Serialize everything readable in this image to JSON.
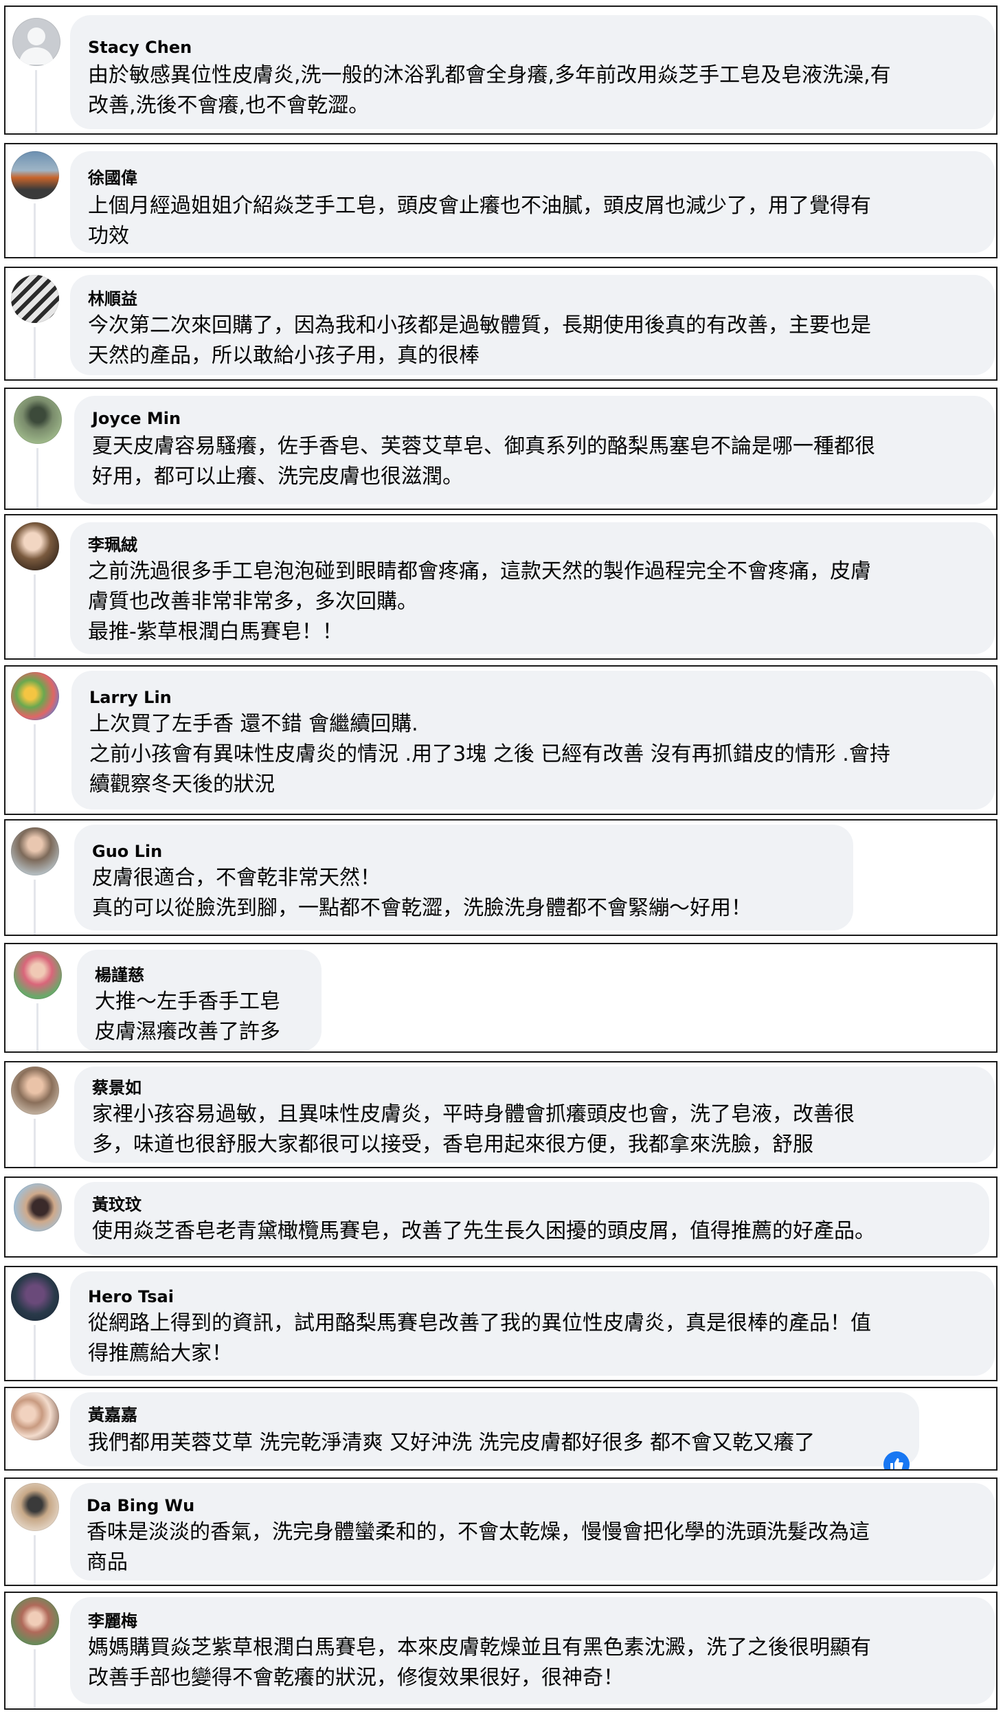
{
  "comments": [
    {
      "name": "Stacy Chen",
      "text": "由於敏感異位性皮膚炎,洗一般的沐浴乳都會全身癢,多年前改用焱芝手工皂及皂液洗澡,有\n改善,洗後不會癢,也不會乾澀。"
    },
    {
      "name": "徐國偉",
      "text": "上個月經過姐姐介紹焱芝手工皂，頭皮會止癢也不油膩，頭皮屑也減少了，用了覺得有\n功效"
    },
    {
      "name": "林順益",
      "text": "今次第二次來回購了，因為我和小孩都是過敏體質，長期使用後真的有改善，主要也是\n天然的產品，所以敢給小孩子用，真的很棒"
    },
    {
      "name": "Joyce Min",
      "text": "夏天皮膚容易騷癢，佐手香皂、芙蓉艾草皂、御真系列的酪梨馬塞皂不論是哪一種都很\n好用，都可以止癢、洗完皮膚也很滋潤。"
    },
    {
      "name": "李珮絨",
      "text": "之前洗過很多手工皂泡泡碰到眼睛都會疼痛，這款天然的製作過程完全不會疼痛，皮膚\n膚質也改善非常非常多，多次回購。\n最推-紫草根潤白馬賽皂！！"
    },
    {
      "name": "Larry Lin",
      "text": "上次買了左手香 還不錯 會繼續回購.\n之前小孩會有異味性皮膚炎的情況 .用了3塊 之後 已經有改善 沒有再抓錯皮的情形 .會持\n續觀察冬天後的狀況"
    },
    {
      "name": "Guo Lin",
      "text": "皮膚很適合，不會乾非常天然！\n真的可以從臉洗到腳，一點都不會乾澀，洗臉洗身體都不會緊繃～好用！"
    },
    {
      "name": "楊謹慈",
      "text": "大推～左手香手工皂\n皮膚濕癢改善了許多"
    },
    {
      "name": "蔡景如",
      "text": "家裡小孩容易過敏，且異味性皮膚炎，平時身體會抓癢頭皮也會，洗了皂液，改善很\n多，味道也很舒服大家都很可以接受，香皂用起來很方便，我都拿來洗臉，舒服"
    },
    {
      "name": "黃玟玟",
      "text": "使用焱芝香皂老青黛橄欖馬賽皂，改善了先生長久困擾的頭皮屑，值得推薦的好產品。"
    },
    {
      "name": "Hero Tsai",
      "text": "從網路上得到的資訊，試用酪梨馬賽皂改善了我的異位性皮膚炎，真是很棒的產品！值\n得推薦給大家！"
    },
    {
      "name": "黃嘉嘉",
      "text": "我們都用芙蓉艾草 洗完乾淨清爽 又好沖洗 洗完皮膚都好很多 都不會又乾又癢了"
    },
    {
      "name": "Da Bing Wu",
      "text": "香味是淡淡的香氣，洗完身體蠻柔和的，不會太乾燥，慢慢會把化學的洗頭洗髮改為這\n商品"
    },
    {
      "name": "李麗梅",
      "text": "媽媽購買焱芝紫草根潤白馬賽皂，本來皮膚乾燥並且有黑色素沈澱，洗了之後很明顯有\n改善手部也變得不會乾癢的狀況，修復效果很好，很神奇！"
    }
  ],
  "reaction": {
    "type": "like",
    "icon": "thumbs-up-icon",
    "color": "#1877f2"
  }
}
